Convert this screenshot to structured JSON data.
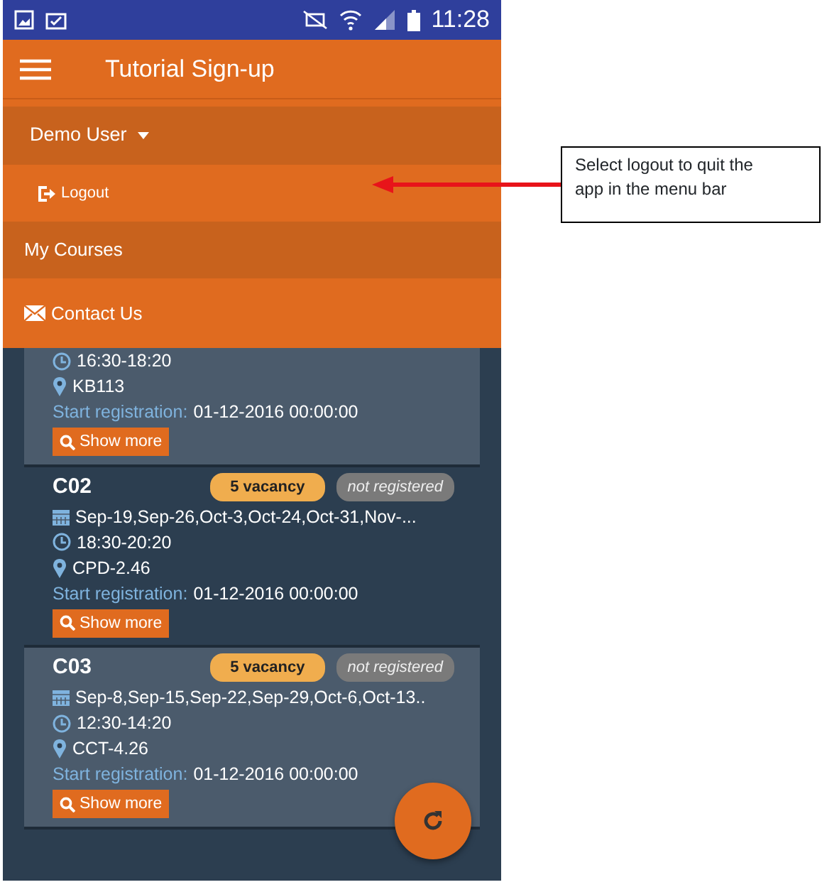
{
  "status_bar": {
    "time": "11:28"
  },
  "app_bar": {
    "title": "Tutorial Sign-up"
  },
  "menu": {
    "user": {
      "label": "Demo User",
      "expanded": true
    },
    "items": [
      {
        "label": "Logout",
        "kind": "sub"
      },
      {
        "label": "My Courses",
        "kind": "plain"
      },
      {
        "label": "Contact Us",
        "kind": "mail"
      }
    ]
  },
  "courses": [
    {
      "time": "16:30-18:20",
      "room": "KB113",
      "reg_label": "Start registration:",
      "reg_value": "01-12-2016 00:00:00",
      "button": "Show more"
    },
    {
      "code": "C02",
      "vacancy": "5 vacancy",
      "status": "not registered",
      "dates": "Sep-19,Sep-26,Oct-3,Oct-24,Oct-31,Nov-...",
      "time": "18:30-20:20",
      "room": "CPD-2.46",
      "reg_label": "Start registration:",
      "reg_value": "01-12-2016 00:00:00",
      "button": "Show more"
    },
    {
      "code": "C03",
      "vacancy": "5 vacancy",
      "status": "not registered",
      "dates": "Sep-8,Sep-15,Sep-22,Sep-29,Oct-6,Oct-13..",
      "time": "12:30-14:20",
      "room": "CCT-4.26",
      "reg_label": "Start registration:",
      "reg_value": "01-12-2016 00:00:00",
      "button": "Show more"
    }
  ],
  "annotation": {
    "text": "Select logout to quit the app in the menu bar"
  }
}
